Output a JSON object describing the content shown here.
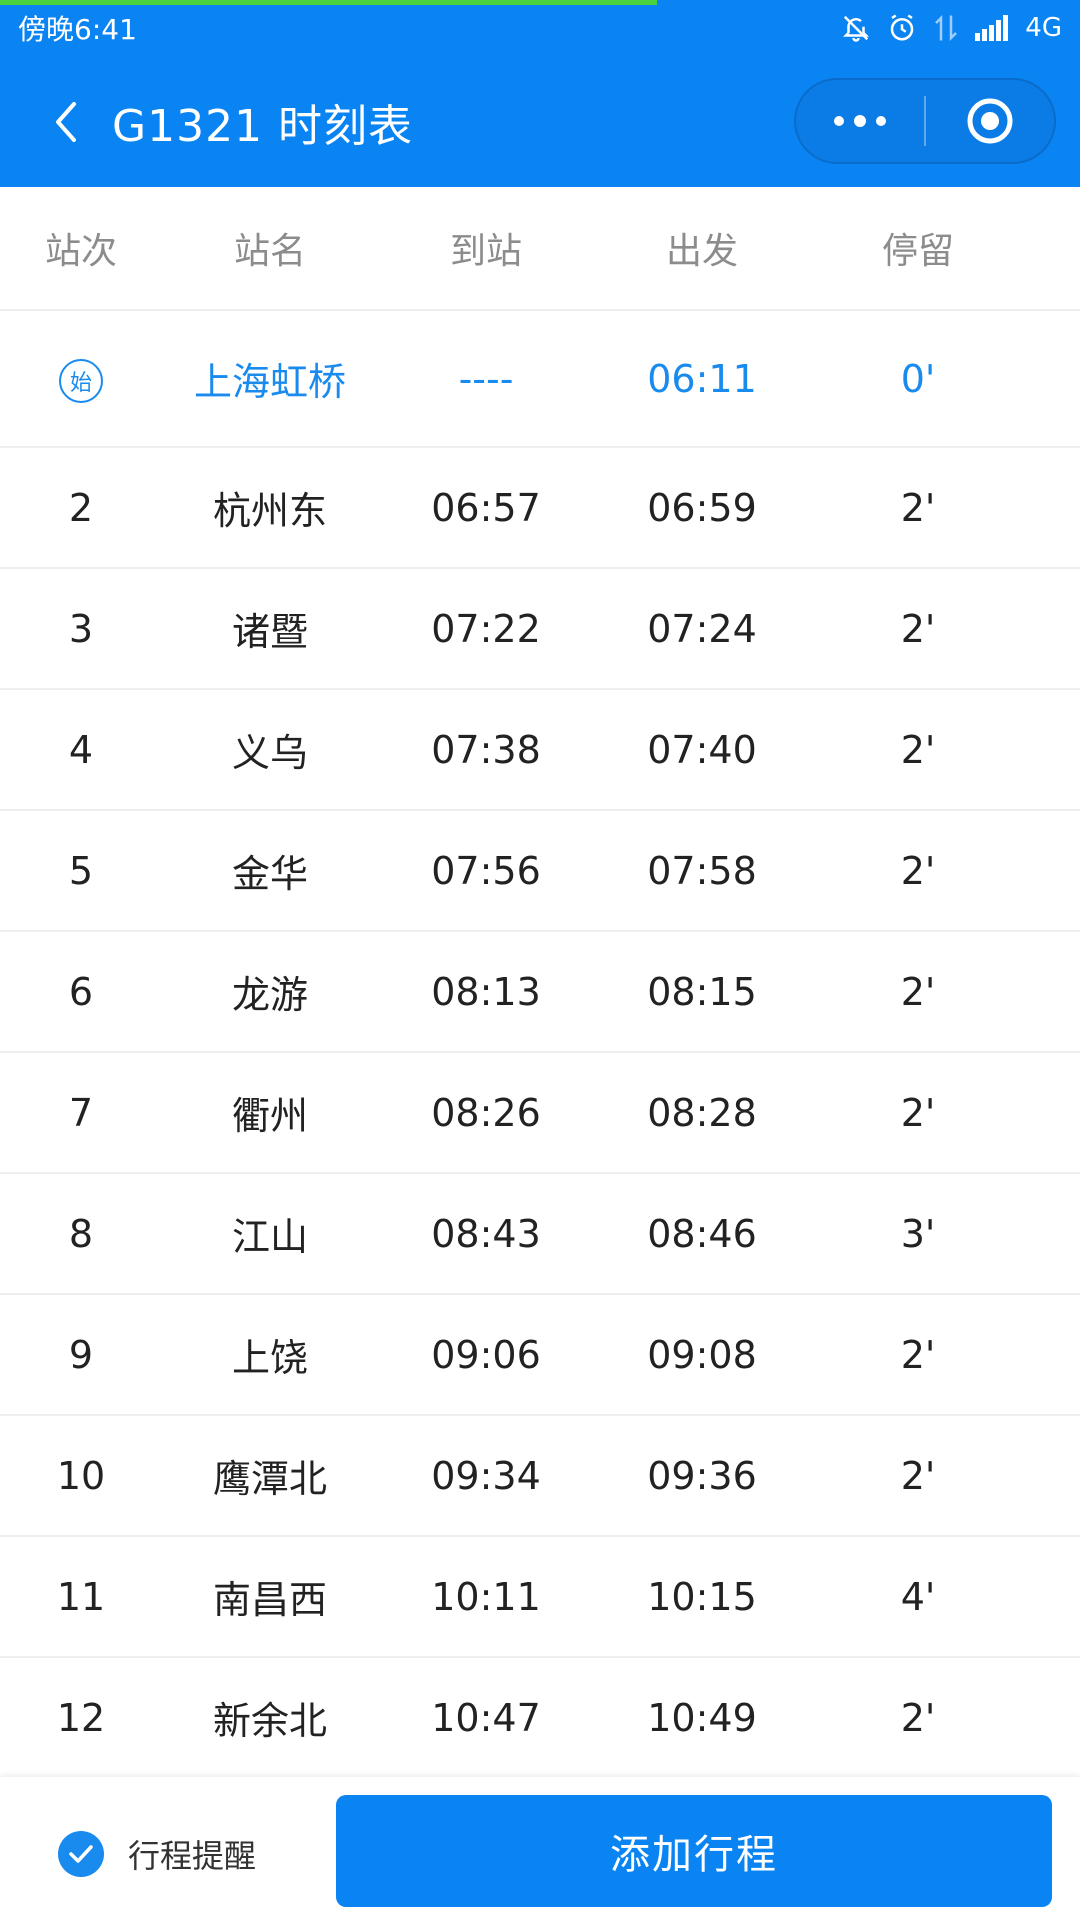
{
  "status_bar": {
    "time": "傍晚6:41",
    "network": "4G"
  },
  "nav": {
    "title": "G1321 时刻表"
  },
  "table": {
    "headers": [
      "站次",
      "站名",
      "到站",
      "出发",
      "停留"
    ],
    "start_badge": "始",
    "rows": [
      {
        "no": "",
        "station": "上海虹桥",
        "arrive": "----",
        "depart": "06:11",
        "stay": "0'"
      },
      {
        "no": "2",
        "station": "杭州东",
        "arrive": "06:57",
        "depart": "06:59",
        "stay": "2'"
      },
      {
        "no": "3",
        "station": "诸暨",
        "arrive": "07:22",
        "depart": "07:24",
        "stay": "2'"
      },
      {
        "no": "4",
        "station": "义乌",
        "arrive": "07:38",
        "depart": "07:40",
        "stay": "2'"
      },
      {
        "no": "5",
        "station": "金华",
        "arrive": "07:56",
        "depart": "07:58",
        "stay": "2'"
      },
      {
        "no": "6",
        "station": "龙游",
        "arrive": "08:13",
        "depart": "08:15",
        "stay": "2'"
      },
      {
        "no": "7",
        "station": "衢州",
        "arrive": "08:26",
        "depart": "08:28",
        "stay": "2'"
      },
      {
        "no": "8",
        "station": "江山",
        "arrive": "08:43",
        "depart": "08:46",
        "stay": "3'"
      },
      {
        "no": "9",
        "station": "上饶",
        "arrive": "09:06",
        "depart": "09:08",
        "stay": "2'"
      },
      {
        "no": "10",
        "station": "鹰潭北",
        "arrive": "09:34",
        "depart": "09:36",
        "stay": "2'"
      },
      {
        "no": "11",
        "station": "南昌西",
        "arrive": "10:11",
        "depart": "10:15",
        "stay": "4'"
      },
      {
        "no": "12",
        "station": "新余北",
        "arrive": "10:47",
        "depart": "10:49",
        "stay": "2'"
      }
    ]
  },
  "bottom": {
    "reminder_label": "行程提醒",
    "reminder_checked": true,
    "add_button": "添加行程"
  },
  "colors": {
    "primary": "#0a84f3",
    "accent_text": "#1a8bee",
    "loading_bar": "#4bd23f"
  }
}
